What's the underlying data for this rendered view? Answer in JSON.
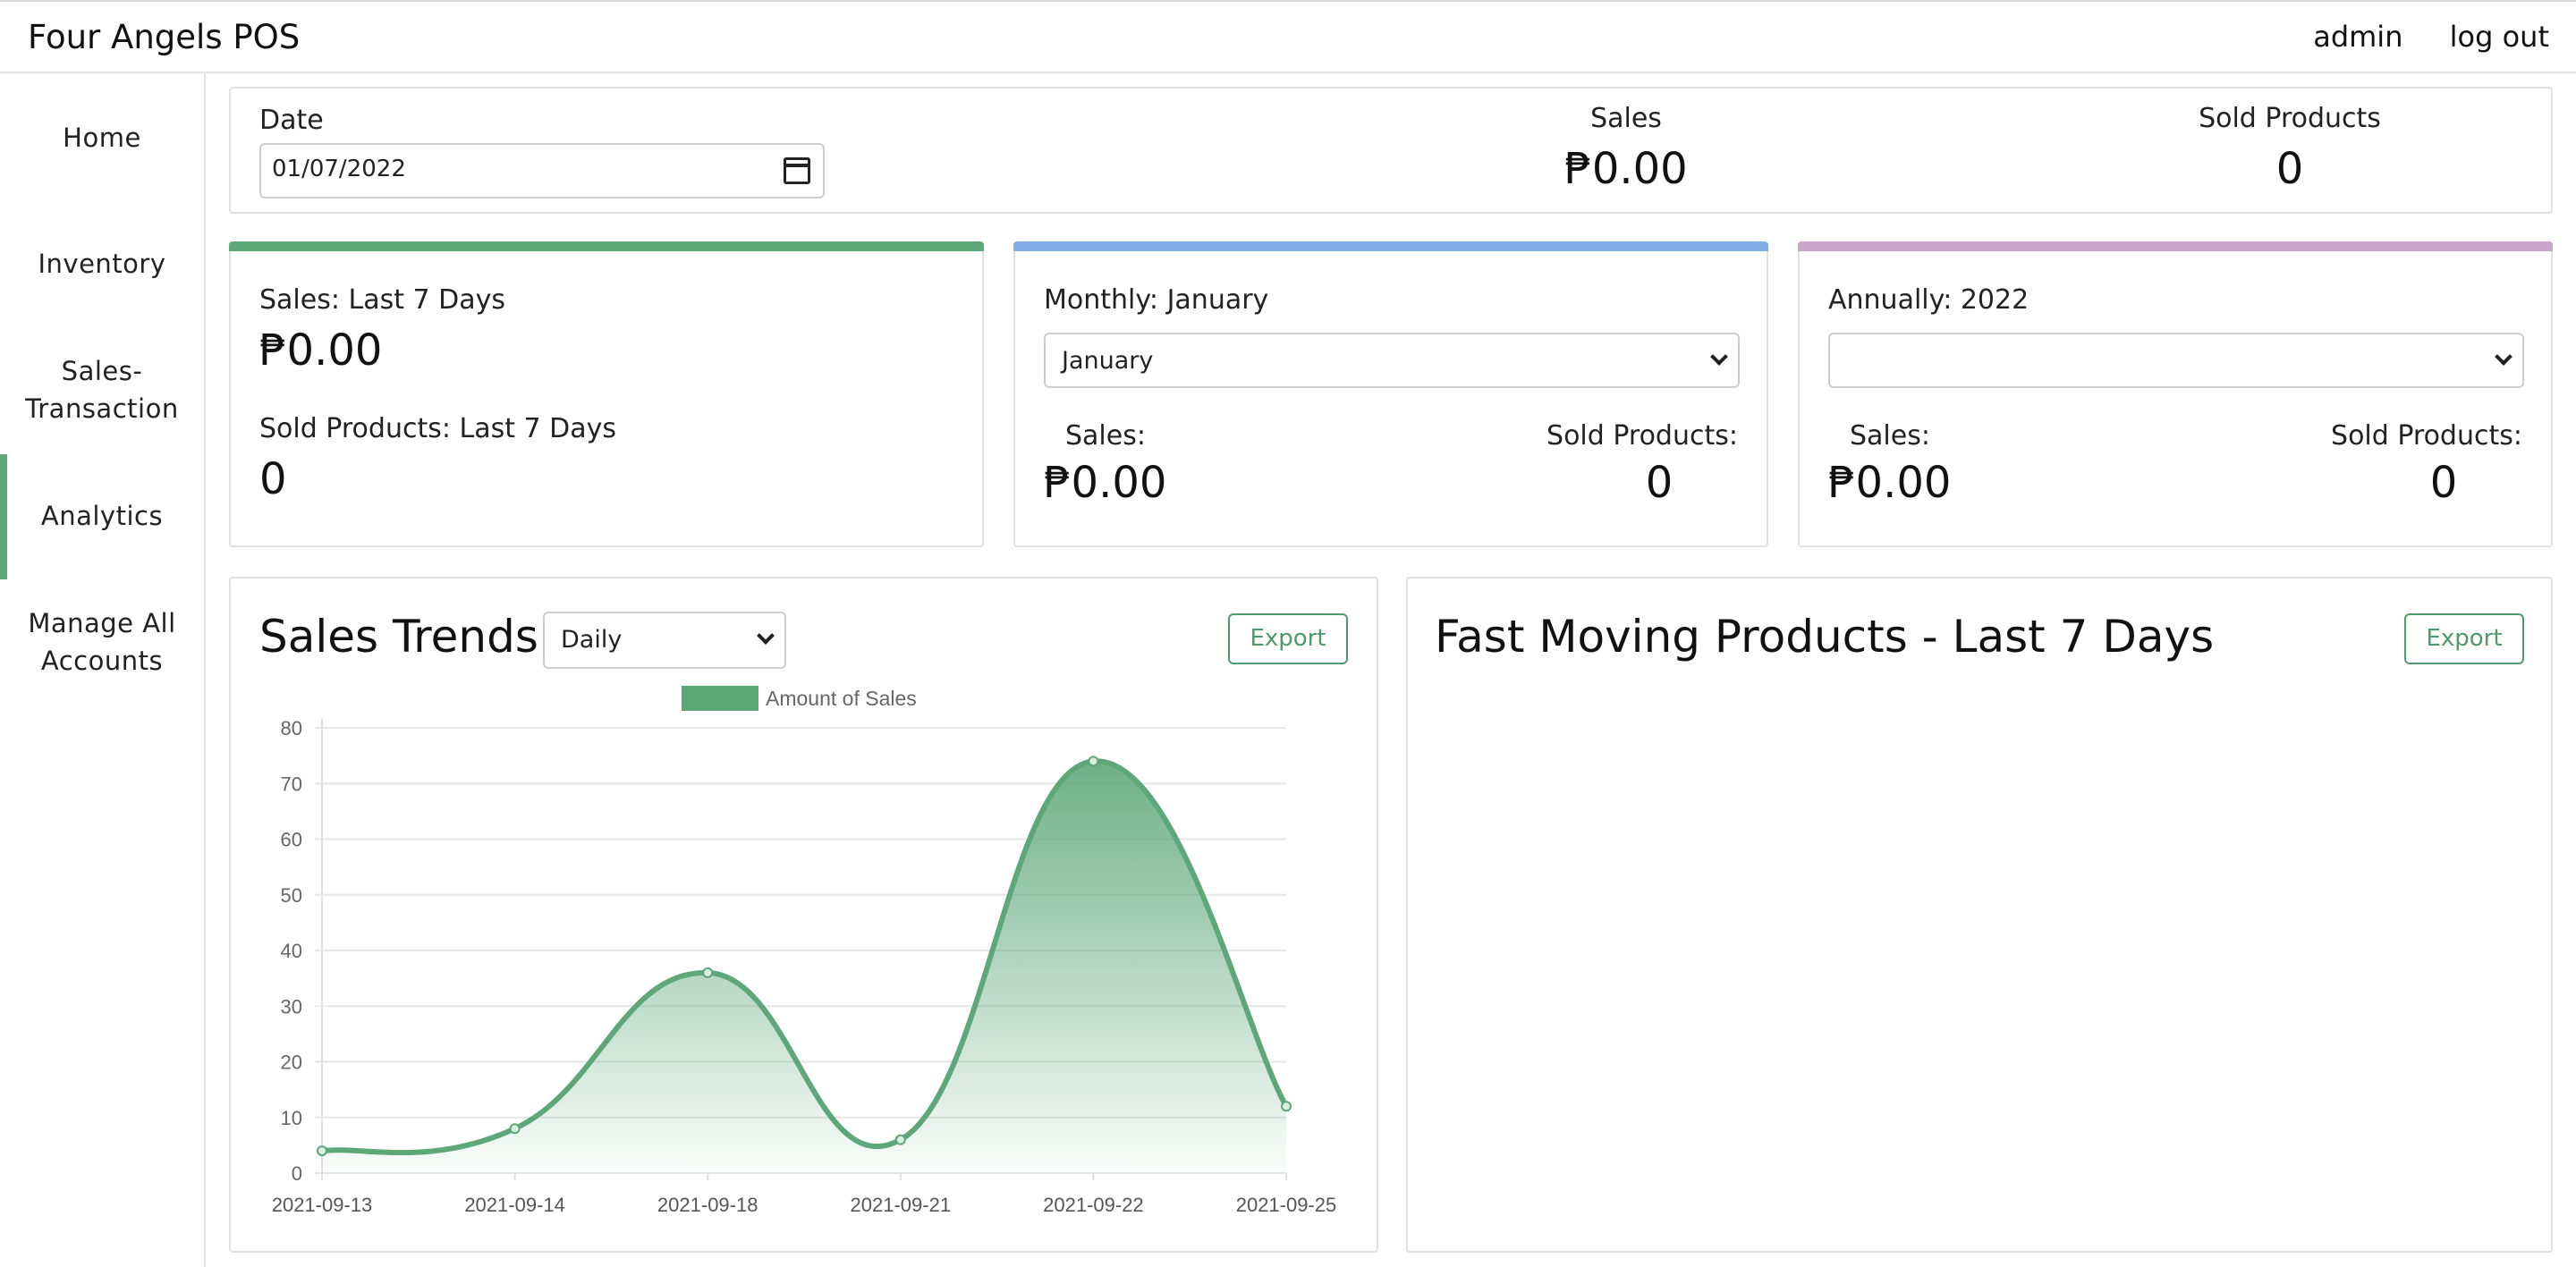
{
  "app": {
    "title": "Four Angels POS",
    "user": "admin",
    "logout": "log out"
  },
  "sidebar": {
    "items": [
      {
        "label": "Home"
      },
      {
        "label": "Inventory"
      },
      {
        "label": "Sales-\nTransaction"
      },
      {
        "label": "Analytics"
      },
      {
        "label": "Manage All\nAccounts"
      }
    ],
    "active": "Analytics"
  },
  "summary": {
    "date_label": "Date",
    "date_value": "01/07/2022",
    "sales_label": "Sales",
    "sales_value": "₱0.00",
    "sold_label": "Sold Products",
    "sold_value": "0"
  },
  "weekly": {
    "accent": "#5ea779",
    "sales_label": "Sales: Last 7 Days",
    "sales_value": "₱0.00",
    "sold_label": "Sold Products: Last 7 Days",
    "sold_value": "0"
  },
  "monthly": {
    "accent": "#84aee6",
    "title": "Monthly: January",
    "select_value": "January",
    "sales_label": "Sales:",
    "sales_value": "₱0.00",
    "sold_label": "Sold Products:",
    "sold_value": "0"
  },
  "annual": {
    "accent": "#c9a5cc",
    "title": "Annually: 2022",
    "select_value": "",
    "sales_label": "Sales:",
    "sales_value": "₱0.00",
    "sold_label": "Sold Products:",
    "sold_value": "0"
  },
  "trends": {
    "title": "Sales Trends",
    "period_value": "Daily",
    "export_label": "Export"
  },
  "fast_moving": {
    "title": "Fast Moving Products - Last 7 Days",
    "export_label": "Export"
  },
  "chart_data": {
    "type": "area",
    "categories": [
      "2021-09-13",
      "2021-09-14",
      "2021-09-18",
      "2021-09-21",
      "2021-09-22",
      "2021-09-25"
    ],
    "series": [
      {
        "name": "Amount of Sales",
        "values": [
          4,
          8,
          36,
          6,
          74,
          12
        ],
        "color": "#5ea779"
      }
    ],
    "ylim": [
      0,
      80
    ],
    "yticks": [
      0,
      10,
      20,
      30,
      40,
      50,
      60,
      70,
      80
    ],
    "grid": true,
    "legend": "top-center"
  }
}
